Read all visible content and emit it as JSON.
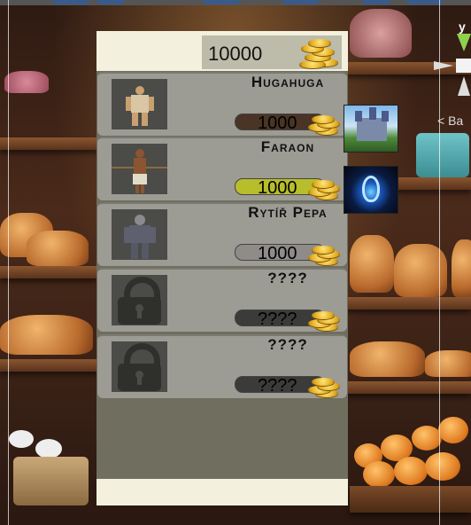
{
  "money": {
    "value": "10000"
  },
  "gizmo": {
    "axis_label": "y",
    "back_label": "< Ba"
  },
  "characters": [
    {
      "name": "Hugahuga",
      "price": "1000",
      "price_color": "#4a3426",
      "locked": false
    },
    {
      "name": "Faraon",
      "price": "1000",
      "price_color": "#b8bd2c",
      "locked": false
    },
    {
      "name": "Rytíř Pepa",
      "price": "1000",
      "price_color": "#8f8b88",
      "locked": false
    },
    {
      "name": "????",
      "price": "????",
      "price_color": "#3b3b39",
      "locked": true
    },
    {
      "name": "????",
      "price": "????",
      "price_color": "#3b3b39",
      "locked": true
    }
  ],
  "side_icons": [
    {
      "name": "castle-icon"
    },
    {
      "name": "blue-flame-icon"
    }
  ]
}
